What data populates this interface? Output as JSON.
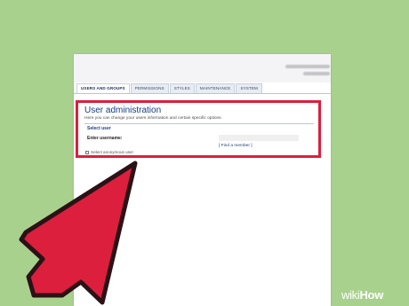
{
  "tabs": [
    {
      "label": "USERS AND GROUPS",
      "active": true
    },
    {
      "label": "PERMISSIONS",
      "active": false
    },
    {
      "label": "STYLES",
      "active": false
    },
    {
      "label": "MAINTENANCE",
      "active": false
    },
    {
      "label": "SYSTEM",
      "active": false
    }
  ],
  "panel": {
    "title": "User administration",
    "description": "Here you can change your users information and certain specific options.",
    "section_title": "Select user",
    "username_label": "Enter username:",
    "username_value": "",
    "find_member_link": "[ Find a member ]",
    "anonymous_label": "Select anonymous user"
  },
  "colors": {
    "background": "#a9d18e",
    "highlight_border": "#dc1f3d",
    "arrow_fill": "#dc1f3d",
    "title_color": "#153c80"
  },
  "icons": {
    "pointer": "red-arrow-icon"
  },
  "watermark": {
    "brand": "wiki",
    "brand_suffix": "How"
  }
}
